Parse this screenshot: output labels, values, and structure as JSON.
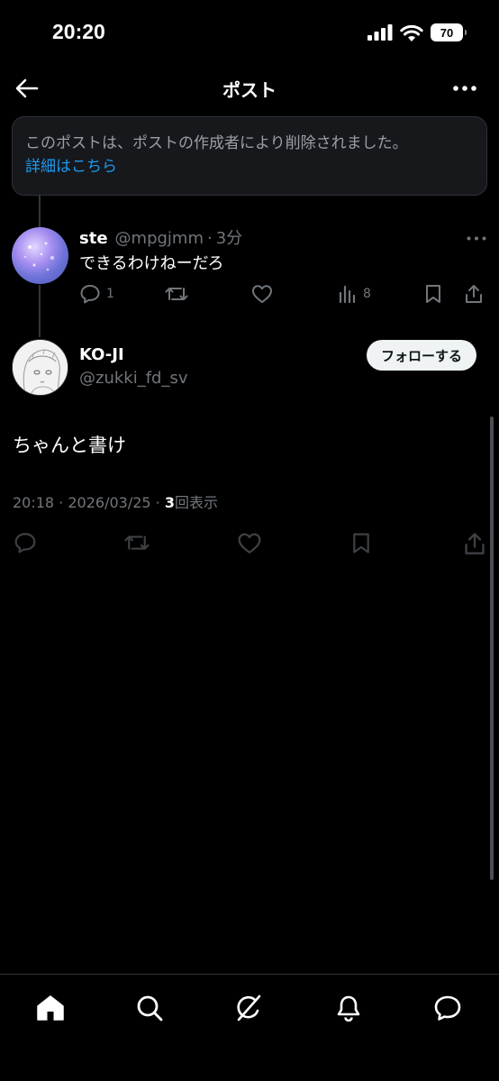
{
  "status_bar": {
    "time": "20:20",
    "battery": "70"
  },
  "header": {
    "title": "ポスト"
  },
  "deleted_notice": {
    "text": "このポストは、ポストの作成者により削除されました。",
    "link": "詳細はこちら"
  },
  "reply": {
    "name": "ste",
    "handle": "@mpgjmm",
    "time": "3分",
    "text": "できるわけねーだろ",
    "reply_count": "1",
    "view_count": "8"
  },
  "main_post": {
    "name": "KO-JI",
    "handle": "@zukki_fd_sv",
    "follow_label": "フォローする",
    "text": "ちゃんと書け",
    "timestamp": "20:18 · 2026/03/25 · ",
    "views_count": "3",
    "views_label": "回表示"
  },
  "icons": {
    "back": "arrow-left-icon",
    "more": "more-horizontal-icon",
    "reply": "reply-icon",
    "repost": "repost-icon",
    "like": "heart-icon",
    "views": "views-icon",
    "bookmark": "bookmark-icon",
    "share": "share-icon",
    "nav": [
      "home-icon",
      "search-icon",
      "grok-icon",
      "notifications-icon",
      "messages-icon"
    ]
  },
  "colors": {
    "background": "#000000",
    "link": "#1d9bf0",
    "muted": "#71767b"
  }
}
